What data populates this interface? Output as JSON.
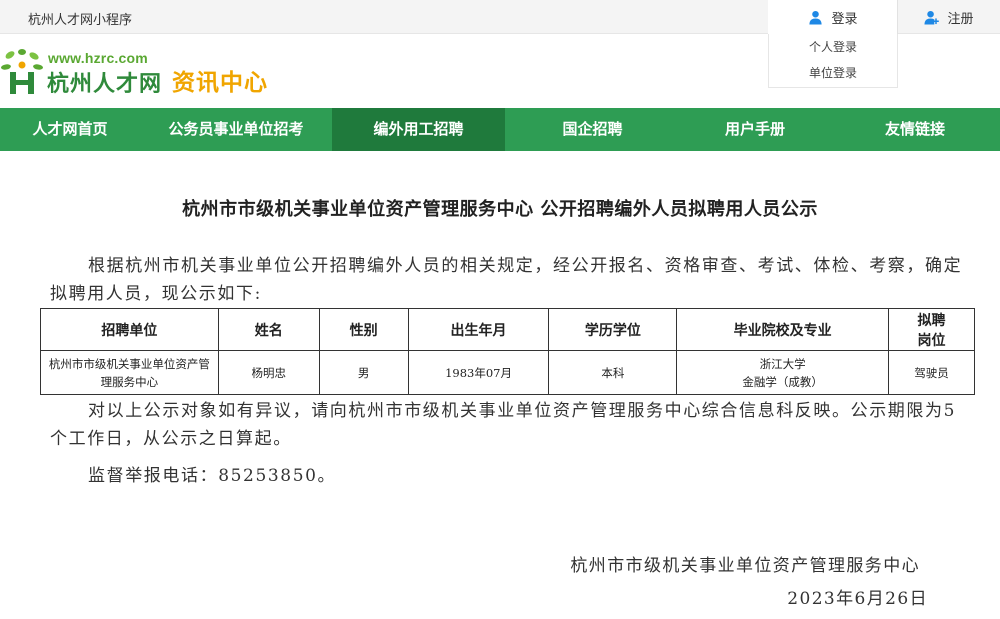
{
  "topbar": {
    "mini_program": "杭州人才网小程序",
    "login_label": "登录",
    "register_label": "注册",
    "login_icon": "user-icon",
    "register_icon": "user-add-icon"
  },
  "dropdown": {
    "items": [
      "个人登录",
      "单位登录"
    ]
  },
  "header": {
    "logo_url": "www.hzrc.com",
    "logo_name": "杭州人才网",
    "section_title": "资讯中心",
    "logo_icon": "hzrc-leaf-logo-icon"
  },
  "nav": {
    "items": [
      {
        "label": "人才网首页"
      },
      {
        "label": "公务员事业单位招考"
      },
      {
        "label": "编外用工招聘"
      },
      {
        "label": "国企招聘"
      },
      {
        "label": "用户手册"
      },
      {
        "label": "友情链接"
      }
    ],
    "active_index": 2
  },
  "article": {
    "title": "杭州市市级机关事业单位资产管理服务中心 公开招聘编外人员拟聘用人员公示",
    "intro": "根据杭州市机关事业单位公开招聘编外人员的相关规定，经公开报名、资格审查、考试、体检、考察，确定拟聘用人员，现公示如下:",
    "objection": "对以上公示对象如有异议，请向杭州市市级机关事业单位资产管理服务中心综合信息科反映。公示期限为5个工作日，从公示之日算起。",
    "hotline": "监督举报电话：85253850。",
    "signature_org": "杭州市市级机关事业单位资产管理服务中心",
    "signature_date": "2023年6月26日"
  },
  "table": {
    "headers": {
      "unit": "招聘单位",
      "name": "姓名",
      "gender": "性别",
      "birth": "出生年月",
      "education": "学历学位",
      "school_line1": "毕业院校及专业",
      "position_line1": "拟聘",
      "position_line2": "岗位"
    },
    "rows": [
      {
        "unit": "杭州市市级机关事业单位资产管理服务中心",
        "name": "杨明忠",
        "gender": "男",
        "birth": "1983年07月",
        "education": "本科",
        "school": "浙江大学",
        "major": "金融学（成教）",
        "position": "驾驶员"
      }
    ]
  },
  "colors": {
    "nav_bg": "#2e9d54",
    "nav_active": "#1f7a3c",
    "brand_green": "#2f8a3b",
    "brand_orange": "#f0a500",
    "icon_blue": "#1e88e5"
  }
}
